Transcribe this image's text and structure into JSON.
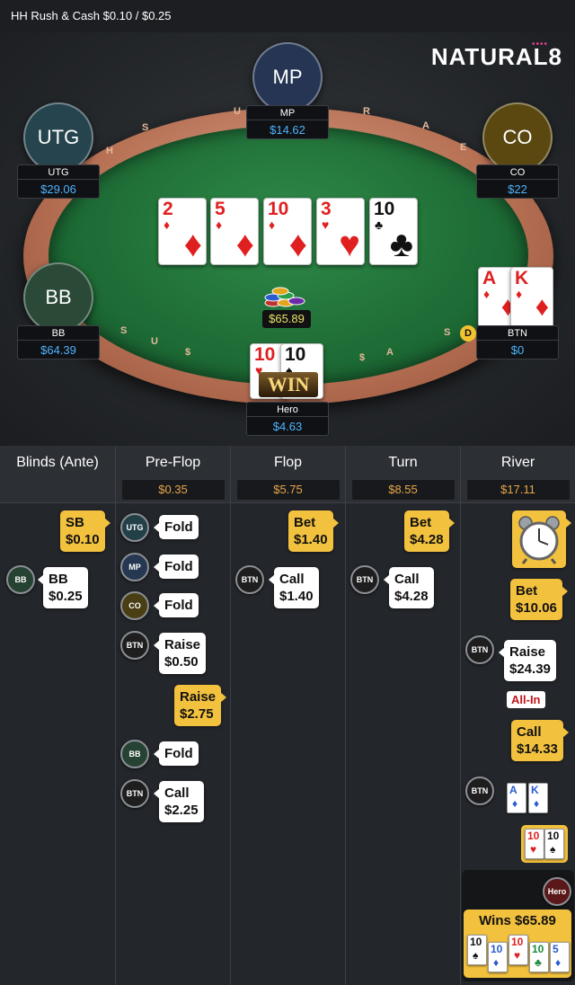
{
  "topbar": {
    "title": "HH  Rush & Cash $0.10 / $0.25"
  },
  "logo": {
    "text": "NATURAL",
    "eight": "8"
  },
  "rail": {
    "marks": [
      "H",
      "S",
      "U",
      "R",
      "A",
      "E",
      "S",
      "U",
      "$",
      "S",
      "A",
      "$"
    ]
  },
  "seats": {
    "mp": {
      "label": "MP",
      "name": "MP",
      "stack": "$14.62",
      "color": "#253553"
    },
    "utg": {
      "label": "UTG",
      "name": "UTG",
      "stack": "$29.06",
      "color": "#25444d"
    },
    "co": {
      "label": "CO",
      "name": "CO",
      "stack": "$22",
      "color": "#5a4810"
    },
    "bb": {
      "label": "BB",
      "name": "BB",
      "stack": "$64.39",
      "color": "#2a4a37"
    },
    "btn": {
      "name": "BTN",
      "stack": "$0"
    },
    "hero": {
      "name": "Hero",
      "stack": "$4.63"
    }
  },
  "board": [
    {
      "rank": "2",
      "suit": "♦",
      "color": "red"
    },
    {
      "rank": "5",
      "suit": "♦",
      "color": "red"
    },
    {
      "rank": "10",
      "suit": "♦",
      "color": "red"
    },
    {
      "rank": "3",
      "suit": "♥",
      "color": "red"
    },
    {
      "rank": "10",
      "suit": "♣",
      "color": "blk"
    }
  ],
  "btn_cards": [
    {
      "rank": "A",
      "suit": "♦"
    },
    {
      "rank": "K",
      "suit": "♦"
    }
  ],
  "hero_cards": [
    {
      "rank": "10",
      "suit": "♥"
    },
    {
      "rank": "10",
      "suit": "♠"
    }
  ],
  "pot": "$65.89",
  "dealer": "D",
  "win_text": "WIN",
  "history": {
    "cols": [
      {
        "title": "Blinds (Ante)",
        "pot": ""
      },
      {
        "title": "Pre-Flop",
        "pot": "$0.35"
      },
      {
        "title": "Flop",
        "pot": "$5.75"
      },
      {
        "title": "Turn",
        "pot": "$8.55"
      },
      {
        "title": "River",
        "pot": "$17.11"
      }
    ],
    "blinds": {
      "sb": "SB\n$0.10",
      "bb_pos": "BB",
      "bb": "BB\n$0.25"
    },
    "preflop": {
      "utg_pos": "UTG",
      "utg": "Fold",
      "mp_pos": "MP",
      "mp": "Fold",
      "co_pos": "CO",
      "co": "Fold",
      "btn_pos": "BTN",
      "btn": "Raise\n$0.50",
      "hero": "Raise\n$2.75",
      "bb_pos": "BB",
      "bb": "Fold",
      "btn2_pos": "BTN",
      "btn2": "Call\n$2.25"
    },
    "flop": {
      "hero": "Bet\n$1.40",
      "btn_pos": "BTN",
      "btn": "Call\n$1.40"
    },
    "turn": {
      "hero": "Bet\n$4.28",
      "btn_pos": "BTN",
      "btn": "Call\n$4.28"
    },
    "river": {
      "hero_bet": "Bet\n$10.06",
      "btn_pos": "BTN",
      "btn_raise": "Raise\n$24.39",
      "allin": "All-In",
      "hero_call": "Call\n$14.33",
      "btn2_pos": "BTN",
      "show_btn": [
        {
          "rank": "A",
          "suit": "♦"
        },
        {
          "rank": "K",
          "suit": "♦"
        }
      ],
      "show_hero": [
        {
          "rank": "10",
          "suit": "♥"
        },
        {
          "rank": "10",
          "suit": "♠"
        }
      ],
      "hero_pos": "Hero",
      "wins": "Wins $65.89",
      "win_cards": [
        {
          "rank": "10",
          "suit": "♠"
        },
        {
          "rank": "10",
          "suit": "♦"
        },
        {
          "rank": "10",
          "suit": "♥"
        },
        {
          "rank": "10",
          "suit": "♣"
        },
        {
          "rank": "5",
          "suit": "♦"
        }
      ]
    }
  }
}
